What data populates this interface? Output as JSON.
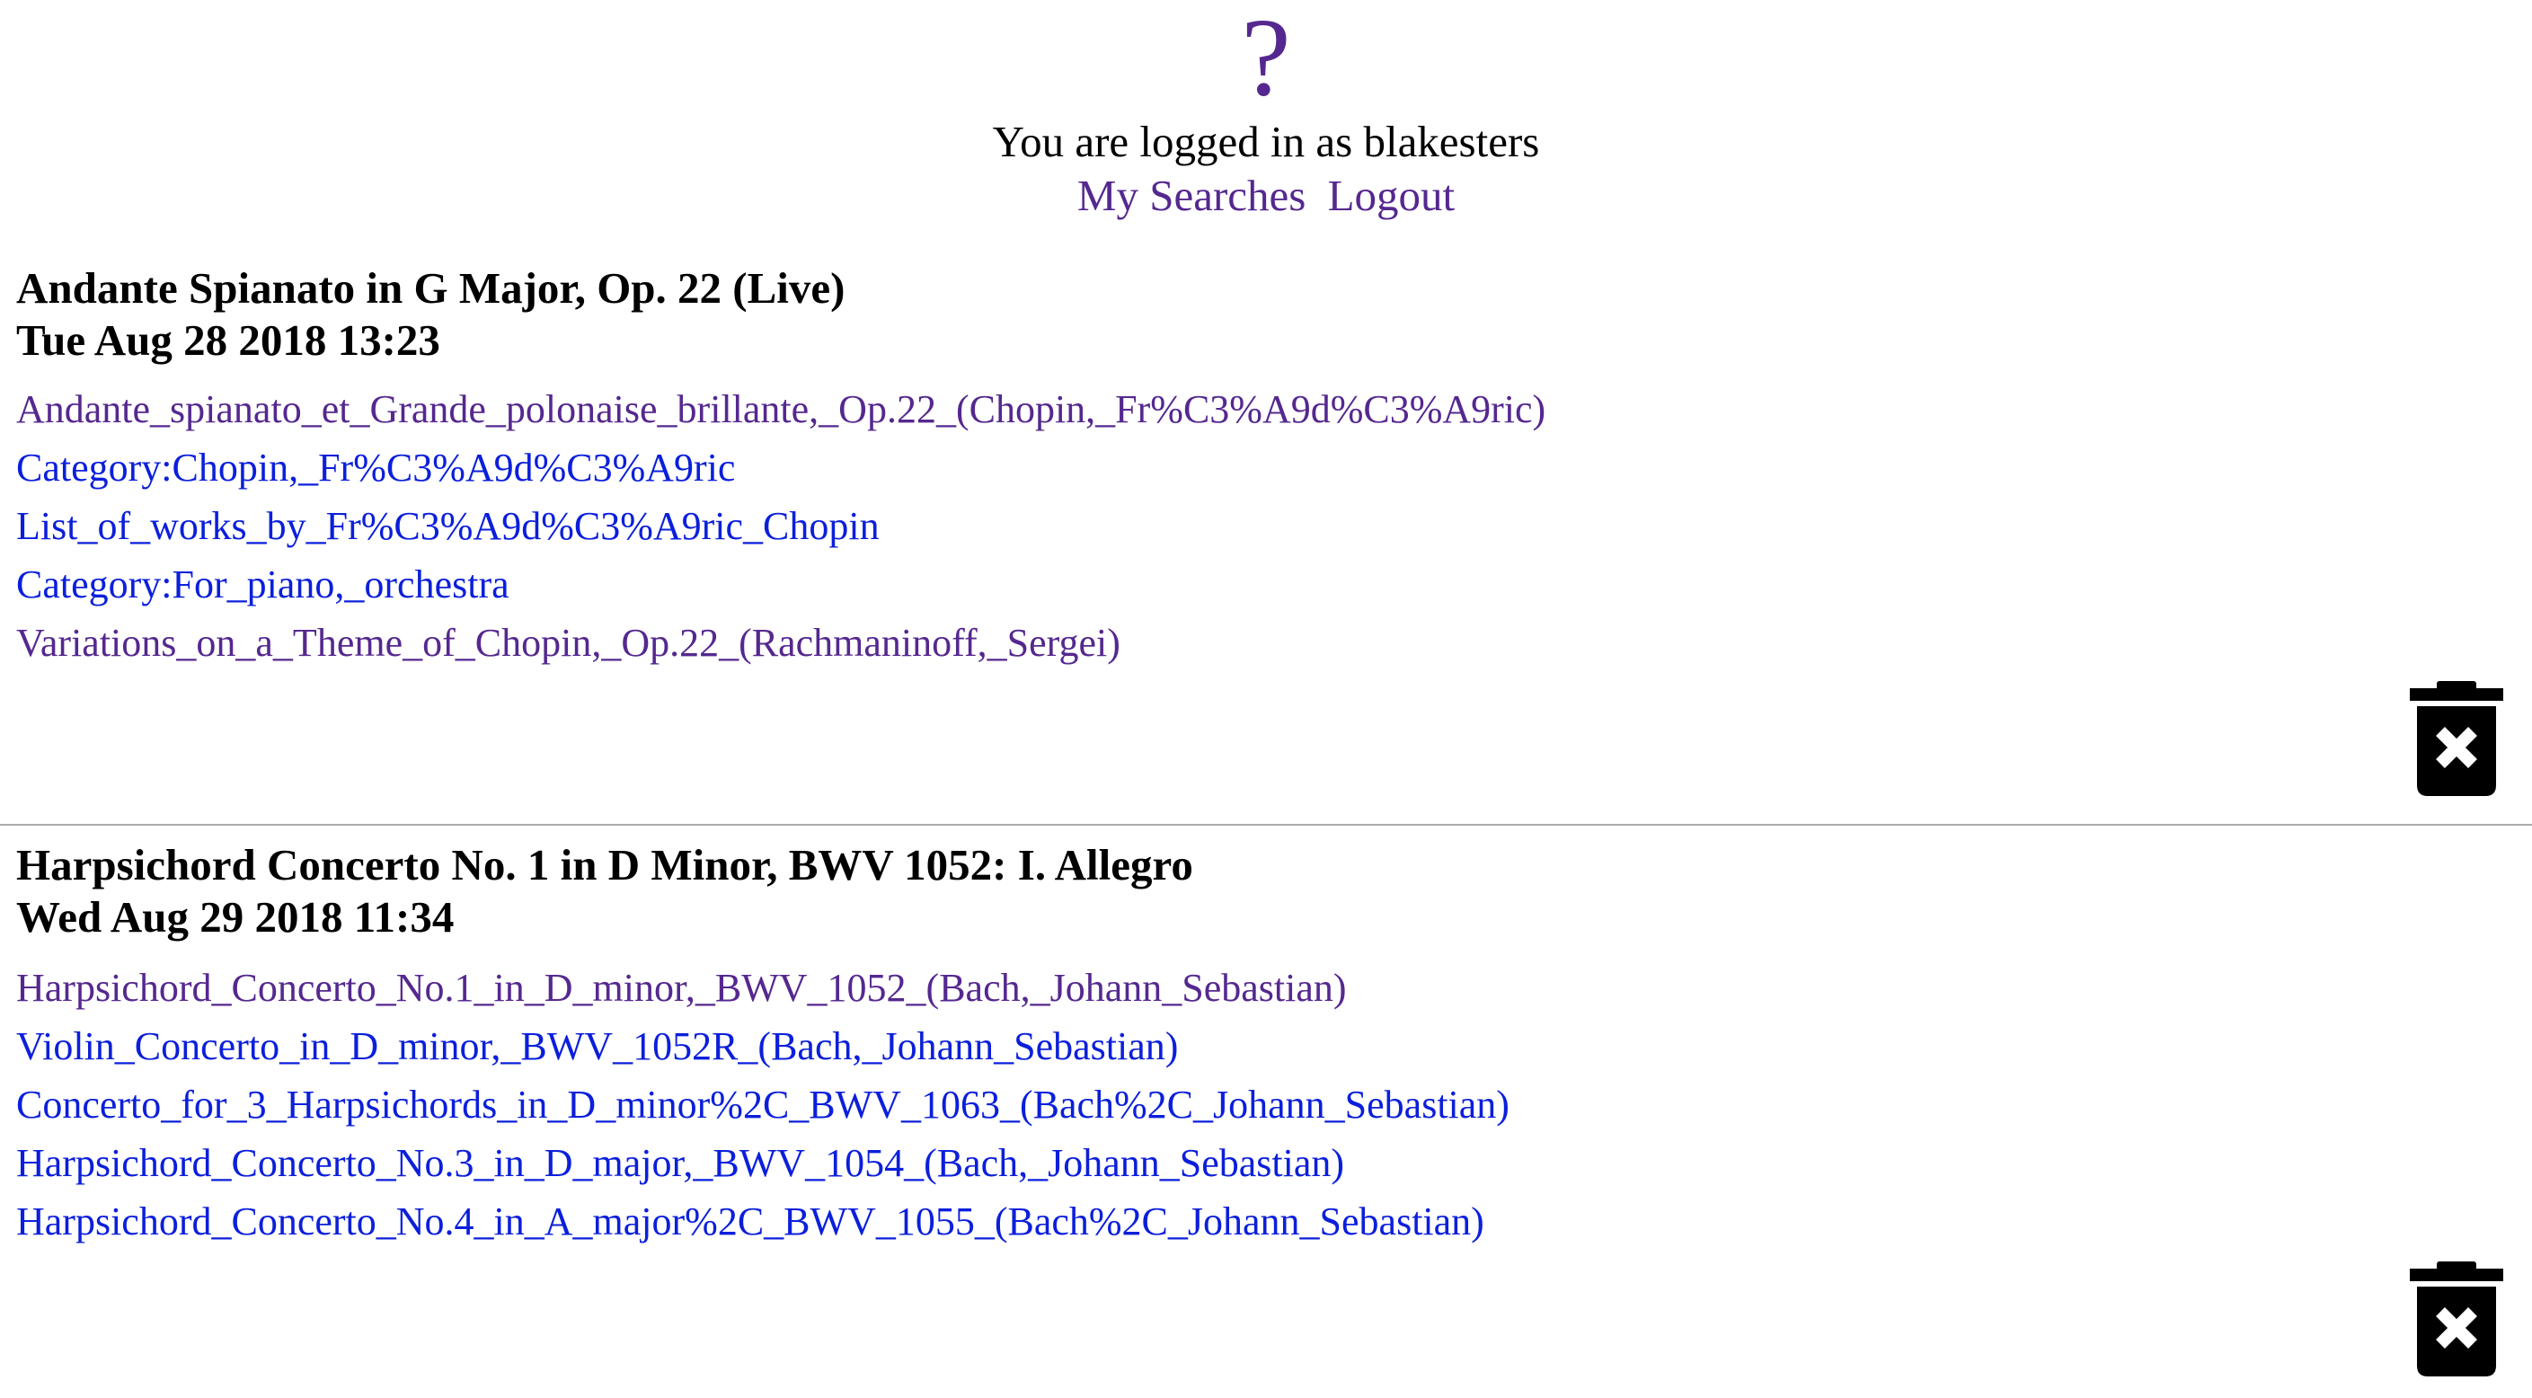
{
  "header": {
    "help_icon": "?",
    "login_status": "You are logged in as blakesters",
    "links": {
      "my_searches": "My Searches",
      "logout": "Logout"
    }
  },
  "entries": [
    {
      "title": "Andante Spianato in G Major, Op. 22 (Live)",
      "timestamp": "Tue Aug 28 2018 13:23",
      "links": [
        {
          "text": "Andante_spianato_et_Grande_polonaise_brillante,_Op.22_(Chopin,_Fr%C3%A9d%C3%A9ric)",
          "state": "visited"
        },
        {
          "text": "Category:Chopin,_Fr%C3%A9d%C3%A9ric",
          "state": "unvisited"
        },
        {
          "text": "List_of_works_by_Fr%C3%A9d%C3%A9ric_Chopin",
          "state": "unvisited"
        },
        {
          "text": "Category:For_piano,_orchestra",
          "state": "unvisited"
        },
        {
          "text": "Variations_on_a_Theme_of_Chopin,_Op.22_(Rachmaninoff,_Sergei)",
          "state": "visited"
        }
      ],
      "delete_icon": "trash-delete-icon"
    },
    {
      "title": "Harpsichord Concerto No. 1 in D Minor, BWV 1052: I. Allegro",
      "timestamp": "Wed Aug 29 2018 11:34",
      "links": [
        {
          "text": "Harpsichord_Concerto_No.1_in_D_minor,_BWV_1052_(Bach,_Johann_Sebastian)",
          "state": "visited"
        },
        {
          "text": "Violin_Concerto_in_D_minor,_BWV_1052R_(Bach,_Johann_Sebastian)",
          "state": "unvisited"
        },
        {
          "text": "Concerto_for_3_Harpsichords_in_D_minor%2C_BWV_1063_(Bach%2C_Johann_Sebastian)",
          "state": "unvisited"
        },
        {
          "text": "Harpsichord_Concerto_No.3_in_D_major,_BWV_1054_(Bach,_Johann_Sebastian)",
          "state": "unvisited"
        },
        {
          "text": "Harpsichord_Concerto_No.4_in_A_major%2C_BWV_1055_(Bach%2C_Johann_Sebastian)",
          "state": "unvisited"
        }
      ],
      "delete_icon": "trash-delete-icon"
    }
  ],
  "colors": {
    "visited_link": "#55288f",
    "unvisited_link": "#0b1fdb",
    "divider": "#aaaaaa",
    "trash_icon": "#000000"
  }
}
